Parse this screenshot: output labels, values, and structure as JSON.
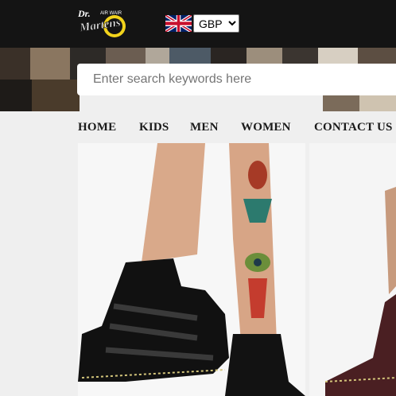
{
  "header": {
    "logo_text_top": "Dr.",
    "logo_text_main": "Martens",
    "logo_text_small": "AIR WAIR",
    "flag_icon": "uk-flag-icon",
    "currency": {
      "selected": "GBP"
    }
  },
  "search": {
    "placeholder": "Enter search keywords here"
  },
  "nav": {
    "items": [
      {
        "label": "HOME"
      },
      {
        "label": "KIDS"
      },
      {
        "label": "MEN"
      },
      {
        "label": "WOMEN"
      },
      {
        "label": "CONTACT US"
      }
    ]
  },
  "colors": {
    "topbar": "#141414",
    "nav_bg": "#efefef",
    "logo_yellow": "#f2d31c"
  }
}
